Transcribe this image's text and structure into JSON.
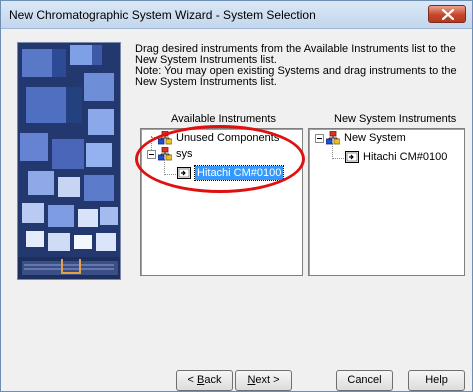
{
  "window": {
    "title": "New Chromatographic System Wizard - System Selection",
    "close_glyph": "✕"
  },
  "instructions": {
    "line1": "Drag desired instruments from the Available Instruments list to the",
    "line2": "New System Instruments list.",
    "line3": "Note:  You may open existing Systems and drag instruments to the",
    "line4": "New System Instruments list."
  },
  "available": {
    "label": "Available Instruments",
    "items": [
      {
        "label": "Unused Components",
        "icon": "network-node-icon"
      },
      {
        "label": "sys",
        "icon": "network-node-icon",
        "expanded": true
      },
      {
        "label": "Hitachi CM#0100",
        "icon": "instrument-icon",
        "selected": true
      }
    ]
  },
  "new_system": {
    "label": "New System Instruments",
    "items": [
      {
        "label": "New System",
        "icon": "network-node-icon",
        "expanded": true
      },
      {
        "label": "Hitachi CM#0100",
        "icon": "instrument-icon"
      }
    ]
  },
  "buttons": {
    "back_pre": "< ",
    "back_mnemonic": "B",
    "back_post": "ack",
    "next_mnemonic": "N",
    "next_post": "ext >",
    "cancel": "Cancel",
    "help": "Help"
  },
  "colors": {
    "selection": "#3399ff",
    "annotation": "#e01010",
    "title_bar": "#c3d6ec"
  }
}
